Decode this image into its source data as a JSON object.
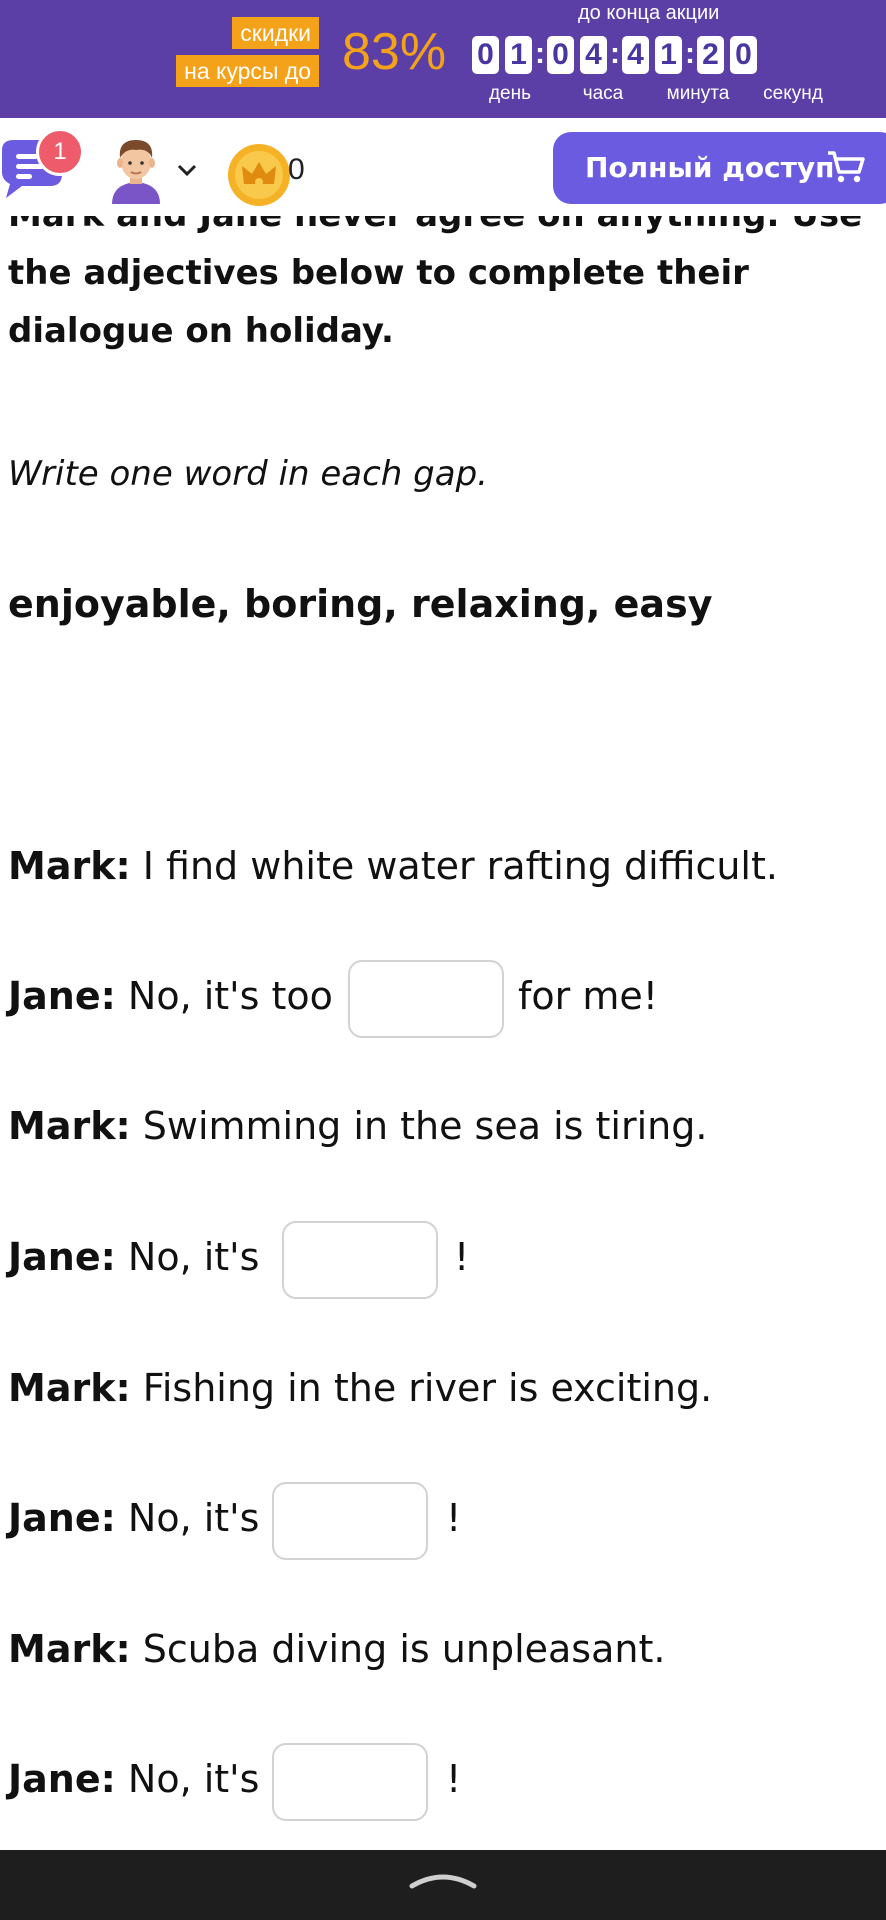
{
  "promo": {
    "label_discount": "скидки",
    "label_courses": "на курсы до",
    "percent": "83%",
    "until_end": "до конца акции",
    "digits": [
      "0",
      "1",
      "0",
      "4",
      "4",
      "1",
      "2",
      "0"
    ],
    "units": [
      "день",
      "часа",
      "минута",
      "секунд"
    ]
  },
  "header": {
    "notifications": "1",
    "coins": "0",
    "full_access": "Полный доступ"
  },
  "exercise": {
    "instruction": "Mark and Jane never agree on anything. Use the adjectives below to complete their dialogue on holiday.",
    "write_hint": "Write one word in each gap.",
    "word_bank": "enjoyable, boring, relaxing, easy",
    "lines": [
      {
        "speaker": "Mark:",
        "text": " I find white water rafting difficult."
      },
      {
        "speaker": "Jane:",
        "text": " No, it's too",
        "after": "for me!"
      },
      {
        "speaker": "Mark:",
        "text": "  Swimming in the sea is tiring."
      },
      {
        "speaker": "Jane:",
        "text": "  No, it's",
        "after": "!"
      },
      {
        "speaker": "Mark:",
        "text": " Fishing in the river is exciting."
      },
      {
        "speaker": "Jane:",
        "text": " No, it's",
        "after": "!"
      },
      {
        "speaker": "Mark:",
        "text": " Scuba diving is unpleasant."
      },
      {
        "speaker": "Jane:",
        "text": " No, it's",
        "after": "!"
      }
    ]
  },
  "colors": {
    "banner": "#5b3fa6",
    "accent_orange": "#f5a21b",
    "button": "#6b5be0",
    "badge": "#ee5b6a"
  },
  "icons": [
    "chat-icon",
    "avatar",
    "chevron-down-icon",
    "crown-coin-icon",
    "cart-icon",
    "swipe-up-icon"
  ]
}
